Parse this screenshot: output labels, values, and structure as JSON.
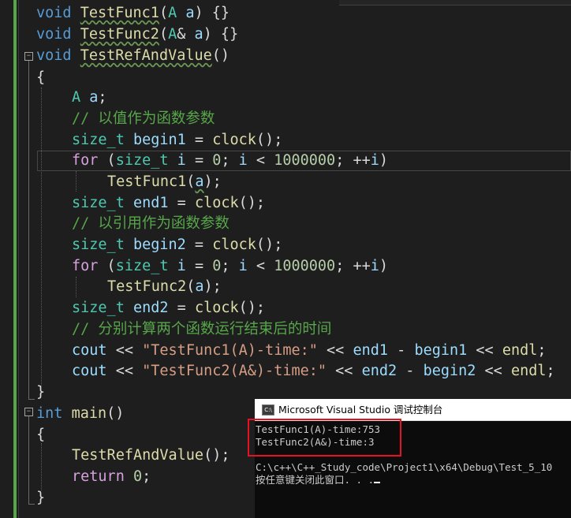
{
  "editor": {
    "lines": [
      {
        "id": "decl1",
        "segments": [
          [
            "k",
            "void"
          ],
          [
            "m",
            " "
          ],
          [
            "f sq",
            "TestFunc1"
          ],
          [
            "m",
            "("
          ],
          [
            "t",
            "A"
          ],
          [
            "m",
            " "
          ],
          [
            "v",
            "a"
          ],
          [
            "m",
            ") {}"
          ]
        ]
      },
      {
        "id": "decl2",
        "segments": [
          [
            "k",
            "void"
          ],
          [
            "m",
            " "
          ],
          [
            "f sq",
            "TestFunc2"
          ],
          [
            "m",
            "("
          ],
          [
            "t",
            "A"
          ],
          [
            "m",
            "& "
          ],
          [
            "v",
            "a"
          ],
          [
            "m",
            ") {}"
          ]
        ]
      },
      {
        "id": "def",
        "segments": [
          [
            "k",
            "void"
          ],
          [
            "m",
            " "
          ],
          [
            "f sq",
            "TestRefAndValue"
          ],
          [
            "m",
            "()"
          ]
        ]
      },
      {
        "id": "open1",
        "segments": [
          [
            "m",
            "{"
          ]
        ]
      },
      {
        "id": "decl-a",
        "segments": [
          [
            "t",
            "A"
          ],
          [
            "m",
            " "
          ],
          [
            "v",
            "a"
          ],
          [
            "m",
            ";"
          ]
        ]
      },
      {
        "id": "comment1",
        "segments": [
          [
            "c",
            "// 以值作为函数参数"
          ]
        ]
      },
      {
        "id": "begin1",
        "segments": [
          [
            "t",
            "size_t"
          ],
          [
            "m",
            " "
          ],
          [
            "v",
            "begin1"
          ],
          [
            "m",
            " = "
          ],
          [
            "f",
            "clock"
          ],
          [
            "m",
            "();"
          ]
        ]
      },
      {
        "id": "for1",
        "segments": [
          [
            "kf",
            "for"
          ],
          [
            "m",
            " ("
          ],
          [
            "t",
            "size_t"
          ],
          [
            "m",
            " "
          ],
          [
            "v",
            "i"
          ],
          [
            "m",
            " = "
          ],
          [
            "n",
            "0"
          ],
          [
            "m",
            "; "
          ],
          [
            "v",
            "i"
          ],
          [
            "m",
            " < "
          ],
          [
            "n",
            "1000000"
          ],
          [
            "m",
            "; ++"
          ],
          [
            "v",
            "i"
          ],
          [
            "m",
            ")"
          ]
        ]
      },
      {
        "id": "call1",
        "segments": [
          [
            "f",
            "TestFunc1"
          ],
          [
            "m",
            "("
          ],
          [
            "v sq",
            "a"
          ],
          [
            "m",
            ");"
          ]
        ]
      },
      {
        "id": "end1",
        "segments": [
          [
            "t",
            "size_t"
          ],
          [
            "m",
            " "
          ],
          [
            "v",
            "end1"
          ],
          [
            "m",
            " = "
          ],
          [
            "f",
            "clock"
          ],
          [
            "m",
            "();"
          ]
        ]
      },
      {
        "id": "comment2",
        "segments": [
          [
            "c",
            "// 以引用作为函数参数"
          ]
        ]
      },
      {
        "id": "begin2",
        "segments": [
          [
            "t",
            "size_t"
          ],
          [
            "m",
            " "
          ],
          [
            "v",
            "begin2"
          ],
          [
            "m",
            " = "
          ],
          [
            "f",
            "clock"
          ],
          [
            "m",
            "();"
          ]
        ]
      },
      {
        "id": "for2",
        "segments": [
          [
            "kf",
            "for"
          ],
          [
            "m",
            " ("
          ],
          [
            "t",
            "size_t"
          ],
          [
            "m",
            " "
          ],
          [
            "v",
            "i"
          ],
          [
            "m",
            " = "
          ],
          [
            "n",
            "0"
          ],
          [
            "m",
            "; "
          ],
          [
            "v",
            "i"
          ],
          [
            "m",
            " < "
          ],
          [
            "n",
            "1000000"
          ],
          [
            "m",
            "; ++"
          ],
          [
            "v",
            "i"
          ],
          [
            "m",
            ")"
          ]
        ]
      },
      {
        "id": "call2",
        "segments": [
          [
            "f",
            "TestFunc2"
          ],
          [
            "m",
            "("
          ],
          [
            "v",
            "a"
          ],
          [
            "m",
            ");"
          ]
        ]
      },
      {
        "id": "end2",
        "segments": [
          [
            "t",
            "size_t"
          ],
          [
            "m",
            " "
          ],
          [
            "v",
            "end2"
          ],
          [
            "m",
            " = "
          ],
          [
            "f",
            "clock"
          ],
          [
            "m",
            "();"
          ]
        ]
      },
      {
        "id": "comment3",
        "segments": [
          [
            "c",
            "// 分别计算两个函数运行结束后的时间"
          ]
        ]
      },
      {
        "id": "cout1",
        "segments": [
          [
            "v",
            "cout"
          ],
          [
            "m",
            " << "
          ],
          [
            "s",
            "\"TestFunc1(A)-time:\""
          ],
          [
            "m",
            " << "
          ],
          [
            "v",
            "end1"
          ],
          [
            "m",
            " - "
          ],
          [
            "v",
            "begin1"
          ],
          [
            "m",
            " << "
          ],
          [
            "f",
            "endl"
          ],
          [
            "m",
            ";"
          ]
        ]
      },
      {
        "id": "cout2",
        "segments": [
          [
            "v",
            "cout"
          ],
          [
            "m",
            " << "
          ],
          [
            "s",
            "\"TestFunc2(A&)-time:\""
          ],
          [
            "m",
            " << "
          ],
          [
            "v",
            "end2"
          ],
          [
            "m",
            " - "
          ],
          [
            "v",
            "begin2"
          ],
          [
            "m",
            " << "
          ],
          [
            "f",
            "endl"
          ],
          [
            "m",
            ";"
          ]
        ]
      },
      {
        "id": "close1",
        "segments": [
          [
            "m",
            "}"
          ]
        ]
      },
      {
        "id": "main",
        "segments": [
          [
            "k",
            "int"
          ],
          [
            "m",
            " "
          ],
          [
            "f",
            "main"
          ],
          [
            "m",
            "()"
          ]
        ]
      },
      {
        "id": "open2",
        "segments": [
          [
            "m",
            "{"
          ]
        ]
      },
      {
        "id": "call-ref",
        "segments": [
          [
            "f",
            "TestRefAndValue"
          ],
          [
            "m",
            "();"
          ]
        ]
      },
      {
        "id": "return",
        "segments": [
          [
            "kf",
            "return"
          ],
          [
            "m",
            " "
          ],
          [
            "n",
            "0"
          ],
          [
            "m",
            ";"
          ]
        ]
      },
      {
        "id": "close2",
        "segments": [
          [
            "m",
            "}"
          ]
        ]
      }
    ]
  },
  "console": {
    "icon_label": "C:\\",
    "title": "Microsoft Visual Studio 调试控制台",
    "output": [
      "TestFunc1(A)-time:753",
      "TestFunc2(A&)-time:3",
      "",
      "C:\\c++\\C++_Study_code\\Project1\\x64\\Debug\\Test_5_10",
      "按任意键关闭此窗口. . ."
    ]
  },
  "colors": {
    "editor_bg": "#1e1e1e",
    "keyword": "#569cd6",
    "function": "#dcdcaa",
    "type": "#4ec9b0",
    "variable": "#9cdcfe",
    "comment": "#57a64a",
    "string": "#d69d85",
    "number": "#b5cea8",
    "control_keyword": "#d8a0df",
    "highlight_box": "#e81123"
  }
}
